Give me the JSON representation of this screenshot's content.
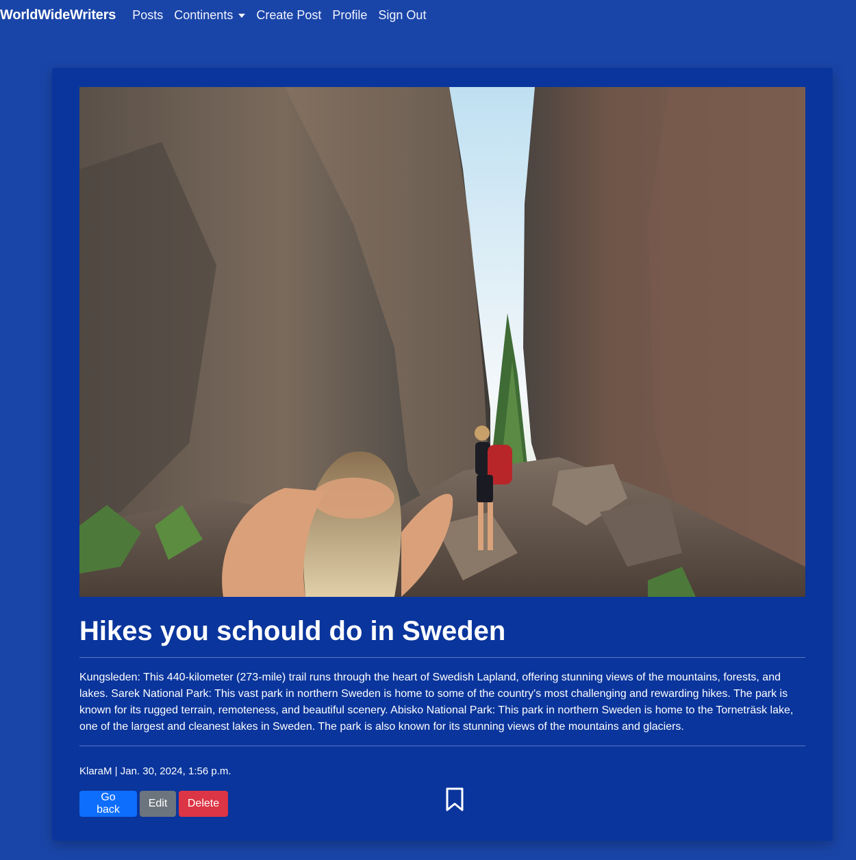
{
  "navbar": {
    "brand": "WorldWideWriters",
    "links": {
      "posts": "Posts",
      "continents": "Continents",
      "create_post": "Create Post",
      "profile": "Profile",
      "sign_out": "Sign Out"
    }
  },
  "post": {
    "image_icon": "photo-canyon-hikers",
    "title": "Hikes you schould do in Sweden",
    "body": "Kungsleden: This 440-kilometer (273-mile) trail runs through the heart of Swedish Lapland, offering stunning views of the mountains, forests, and lakes. Sarek National Park: This vast park in northern Sweden is home to some of the country's most challenging and rewarding hikes. The park is known for its rugged terrain, remoteness, and beautiful scenery. Abisko National Park: This park in northern Sweden is home to the Torneträsk lake, one of the largest and cleanest lakes in Sweden. The park is also known for its stunning views of the mountains and glaciers.",
    "meta": "KlaraM | Jan. 30, 2024, 1:56 p.m."
  },
  "actions": {
    "go_back": "Go back",
    "edit": "Edit",
    "delete": "Delete",
    "bookmark_icon": "bookmark-icon"
  },
  "colors": {
    "page_bg": "#1a45a8",
    "card_bg": "#0a359c",
    "primary": "#0d6efd",
    "secondary": "#6c757d",
    "danger": "#dc3545"
  }
}
